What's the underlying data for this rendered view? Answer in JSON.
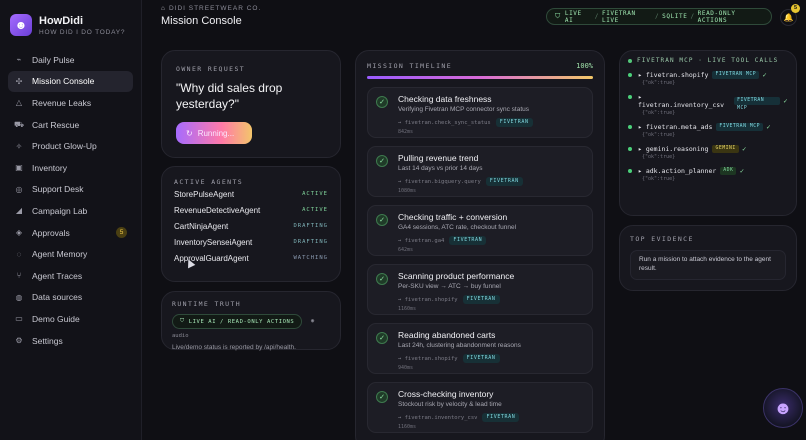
{
  "brand": {
    "name": "HowDidi",
    "tagline": "HOW DID I DO TODAY?",
    "logo_icon": "robot-icon"
  },
  "nav": {
    "items": [
      {
        "label": "Daily Pulse",
        "icon": "pulse-icon",
        "glyph": "⌁"
      },
      {
        "label": "Mission Console",
        "icon": "route-icon",
        "glyph": "✣",
        "active": true
      },
      {
        "label": "Revenue Leaks",
        "icon": "warning-icon",
        "glyph": "△"
      },
      {
        "label": "Cart Rescue",
        "icon": "cart-icon",
        "glyph": "⛟"
      },
      {
        "label": "Product Glow-Up",
        "icon": "magic-wand-icon",
        "glyph": "✧"
      },
      {
        "label": "Inventory",
        "icon": "box-icon",
        "glyph": "▣"
      },
      {
        "label": "Support Desk",
        "icon": "headset-icon",
        "glyph": "◎"
      },
      {
        "label": "Campaign Lab",
        "icon": "megaphone-icon",
        "glyph": "◢"
      },
      {
        "label": "Approvals",
        "icon": "shield-check-icon",
        "glyph": "◈",
        "badge": "5"
      },
      {
        "label": "Agent Memory",
        "icon": "brain-icon",
        "glyph": "◌"
      },
      {
        "label": "Agent Traces",
        "icon": "branch-icon",
        "glyph": "⑂"
      },
      {
        "label": "Data sources",
        "icon": "database-icon",
        "glyph": "◍"
      },
      {
        "label": "Demo Guide",
        "icon": "monitor-icon",
        "glyph": "▭"
      },
      {
        "label": "Settings",
        "icon": "gear-icon",
        "glyph": "⚙"
      }
    ]
  },
  "header": {
    "breadcrumb": "DIDI STREETWEAR CO.",
    "title": "Mission Console",
    "status": [
      "LIVE AI",
      "FIVETRAN LIVE",
      "SQLITE",
      "READ-ONLY ACTIONS"
    ],
    "notifications": "5"
  },
  "owner": {
    "label": "OWNER REQUEST",
    "question": "\"Why did sales drop yesterday?\"",
    "button": "Running..."
  },
  "agents": {
    "label": "ACTIVE AGENTS",
    "rows": [
      {
        "name": "StorePulseAgent",
        "state": "ACTIVE"
      },
      {
        "name": "RevenueDetectiveAgent",
        "state": "ACTIVE"
      },
      {
        "name": "CartNinjaAgent",
        "state": "DRAFTING"
      },
      {
        "name": "InventorySenseiAgent",
        "state": "DRAFTING"
      },
      {
        "name": "ApprovalGuardAgent",
        "state": "WATCHING"
      }
    ]
  },
  "runtime": {
    "label": "RUNTIME TRUTH",
    "pill": "LIVE AI / READ-ONLY ACTIONS",
    "audio": "audio",
    "note": "Live/demo status is reported by /api/health."
  },
  "timeline": {
    "label": "MISSION TIMELINE",
    "percent": "100%",
    "progress": 1.0,
    "steps": [
      {
        "title": "Checking data freshness",
        "sub": "Verifying Fivetran MCP connector sync status",
        "call": "→ fivetran.check_sync_status",
        "tag": "FIVETRAN",
        "time": "842ms"
      },
      {
        "title": "Pulling revenue trend",
        "sub": "Last 14 days vs prior 14 days",
        "call": "→ fivetran.bigquery.query",
        "tag": "FIVETRAN",
        "time": "1080ms"
      },
      {
        "title": "Checking traffic + conversion",
        "sub": "GA4 sessions, ATC rate, checkout funnel",
        "call": "→ fivetran.ga4",
        "tag": "FIVETRAN",
        "time": "642ms"
      },
      {
        "title": "Scanning product performance",
        "sub": "Per-SKU view → ATC → buy funnel",
        "call": "→ fivetran.shopify",
        "tag": "FIVETRAN",
        "time": "1160ms"
      },
      {
        "title": "Reading abandoned carts",
        "sub": "Last 24h, clustering abandonment reasons",
        "call": "→ fivetran.shopify",
        "tag": "FIVETRAN",
        "time": "940ms"
      },
      {
        "title": "Cross-checking inventory",
        "sub": "Stockout risk by velocity & lead time",
        "call": "→ fivetran.inventory_csv",
        "tag": "FIVETRAN",
        "time": "1160ms"
      }
    ]
  },
  "tools": {
    "label": "FIVETRAN MCP · LIVE TOOL CALLS",
    "calls": [
      {
        "name": "▸ fivetran.shopify",
        "tag": "FIVETRAN MCP",
        "kind": "mcp",
        "result": "{\"ok\":true}"
      },
      {
        "name": "▸ fivetran.inventory_csv",
        "tag": "FIVETRAN MCP",
        "kind": "mcp",
        "result": "{\"ok\":true}"
      },
      {
        "name": "▸ fivetran.meta_ads",
        "tag": "FIVETRAN MCP",
        "kind": "mcp",
        "result": "{\"ok\":true}"
      },
      {
        "name": "▸ gemini.reasoning",
        "tag": "GEMINI",
        "kind": "gemini",
        "result": "{\"ok\":true}"
      },
      {
        "name": "▸ adk.action_planner",
        "tag": "ADK",
        "kind": "adk",
        "result": "{\"ok\":true}"
      }
    ]
  },
  "evidence": {
    "label": "TOP EVIDENCE",
    "text": "Run a mission to attach evidence to the agent result."
  },
  "colors": {
    "accent": "#a66bff",
    "live": "#8fe3a5",
    "fivetran_tag": "#7fd6de",
    "gemini_tag": "#e0cf67"
  }
}
